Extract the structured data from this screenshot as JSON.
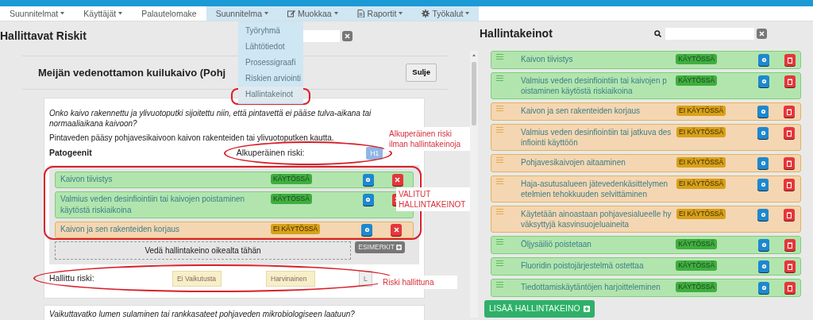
{
  "nav": {
    "items": [
      {
        "label": "Suunnitelmat",
        "dropdown": true,
        "highlighted": false
      },
      {
        "label": "Käyttäjät",
        "dropdown": true,
        "highlighted": false
      },
      {
        "label": "Palautelomake",
        "dropdown": false,
        "highlighted": false
      },
      {
        "label": "Suunnitelma",
        "dropdown": true,
        "highlighted": true
      },
      {
        "label": "Muokkaa",
        "dropdown": true,
        "highlighted": true
      },
      {
        "label": "Raportit",
        "dropdown": true,
        "highlighted": true
      },
      {
        "label": "Työkalut",
        "dropdown": true,
        "highlighted": true
      }
    ]
  },
  "dropdown": {
    "items": [
      {
        "label": "Työryhmä",
        "selected": false
      },
      {
        "label": "Lähtötiedot",
        "selected": false
      },
      {
        "label": "Prosessigraafi",
        "selected": false
      },
      {
        "label": "Riskien arviointi",
        "selected": false
      },
      {
        "label": "Hallintakeinot",
        "selected": true
      }
    ]
  },
  "left": {
    "title": "Hallittavat Riskit",
    "modal": {
      "title": "Meijän vedenottamon kuilukaivo (Pohj",
      "close": "Sulje",
      "card": {
        "question": "Onko kaivo rakennettu ja ylivuotoputki sijoitettu niin, että pintavettä ei pääse tulva-aikana tai normaaliaikana kaivoon?",
        "description": "Pintaveden pääsy pohjavesikaivoon kaivon rakenteiden tai ylivuotoputken kautta.",
        "pathogens_label": "Patogeenit",
        "original_risk_label": "Alkuperäinen riski:",
        "original_risk": "H1",
        "selected_measures": [
          {
            "label": "Kaivon tiivistys",
            "active": true,
            "status": "KÄYTÖSSÄ"
          },
          {
            "label": "Valmius veden desinfiointiin tai kaivojen poistaminen käytöstä riskiaikoina",
            "active": true,
            "status": "KÄYTÖSSÄ"
          },
          {
            "label": "Kaivon ja sen rakenteiden korjaus",
            "active": false,
            "status": "EI KÄYTÖSSÄ"
          }
        ],
        "drop_zone": "Vedä hallintakeino oikealta tähän",
        "examples_button": "ESIMERKIT",
        "managed_risk_label": "Hallittu riski:",
        "managed_risk": [
          {
            "kind": "field",
            "text": "Ei Vaikutusta"
          },
          {
            "kind": "field",
            "text": "Harvinainen"
          },
          {
            "kind": "level",
            "text": "L"
          }
        ]
      },
      "next_question": "Vaikuttavatko lumen sulaminen tai rankkasateet pohjaveden mikrobiologiseen laatuun?"
    }
  },
  "annotations": [
    {
      "text": "Alkuperäinen riski ilman hallintakeinoja"
    },
    {
      "text": "VALITUT HALLINTAKEINOT"
    },
    {
      "text": "Riski hallittuna"
    }
  ],
  "right": {
    "title": "Hallintakeinot",
    "measures": [
      {
        "label": "Kaivon tiivistys",
        "active": true,
        "status": "KÄYTÖSSÄ"
      },
      {
        "label": "Valmius veden desinfiointiin tai kaivojen poistaminen käytöstä riskiaikoina",
        "active": true,
        "status": "KÄYTÖSSÄ"
      },
      {
        "label": "Kaivon ja sen rakenteiden korjaus",
        "active": false,
        "status": "EI KÄYTÖSSÄ"
      },
      {
        "label": "Valmius veden desinfiointiin tai jatkuva desinfiointi käyttöön",
        "active": false,
        "status": "EI KÄYTÖSSÄ"
      },
      {
        "label": "Pohjavesikaivojen aitaaminen",
        "active": false,
        "status": "EI KÄYTÖSSÄ"
      },
      {
        "label": "Haja-asutusalueen jätevedenkäsittelymenetelmien tehokkuuden selvittäminen",
        "active": false,
        "status": "EI KÄYTÖSSÄ"
      },
      {
        "label": "Käytetään ainoastaan pohjavesialueelle hyväksyttyjä kasvinsuojeluaineita",
        "active": false,
        "status": "EI KÄYTÖSSÄ"
      },
      {
        "label": "Öljysäiliö poistetaan",
        "active": true,
        "status": "KÄYTÖSSÄ"
      },
      {
        "label": "Fluoridin poistojärjestelmä ostettaa",
        "active": true,
        "status": "KÄYTÖSSÄ"
      },
      {
        "label": "Tiedottamiskäytäntöjen harjoitteleminen",
        "active": true,
        "status": "KÄYTÖSSÄ"
      }
    ],
    "add_button": "LISÄÄ HALLINTAKEINO"
  }
}
